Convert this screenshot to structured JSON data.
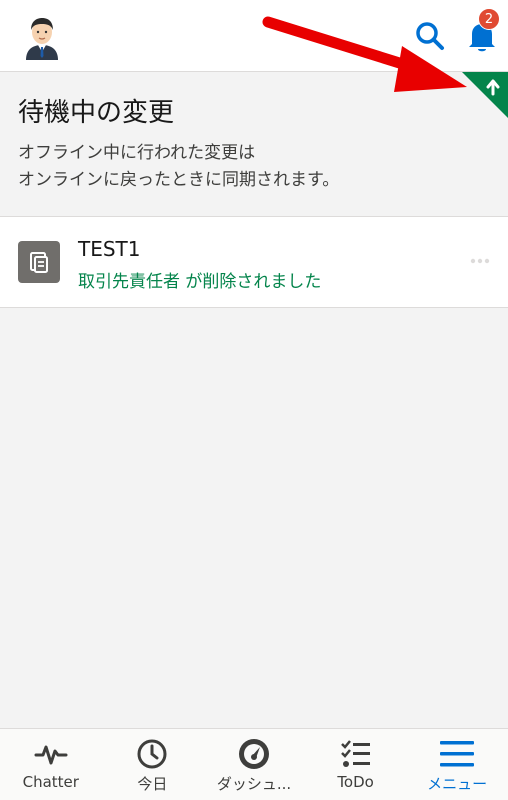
{
  "header": {
    "avatar": "avatar-person-icon",
    "search_icon": "search-icon",
    "bell_icon": "bell-icon",
    "notification_count": "2",
    "sync_corner_icon": "arrow-up-icon"
  },
  "main": {
    "title": "待機中の変更",
    "description_line1": "オフライン中に行われた変更は",
    "description_line2": "オンラインに戻ったときに同期されます。"
  },
  "pending_changes": [
    {
      "name": "TEST1",
      "status": "取引先責任者 が削除されました",
      "icon": "record-icon",
      "more_icon": "more-icon"
    }
  ],
  "tabbar": {
    "tabs": [
      {
        "label": "Chatter",
        "icon": "pulse-icon"
      },
      {
        "label": "今日",
        "icon": "clock-icon"
      },
      {
        "label": "ダッシュ...",
        "icon": "dashboard-gauge-icon"
      },
      {
        "label": "ToDo",
        "icon": "task-list-icon"
      },
      {
        "label": "メニュー",
        "icon": "menu-icon",
        "active": true
      }
    ]
  },
  "colors": {
    "accent": "#0070d2",
    "success": "#04844b",
    "badge": "#e04a32",
    "annotation_arrow": "#e80000"
  }
}
